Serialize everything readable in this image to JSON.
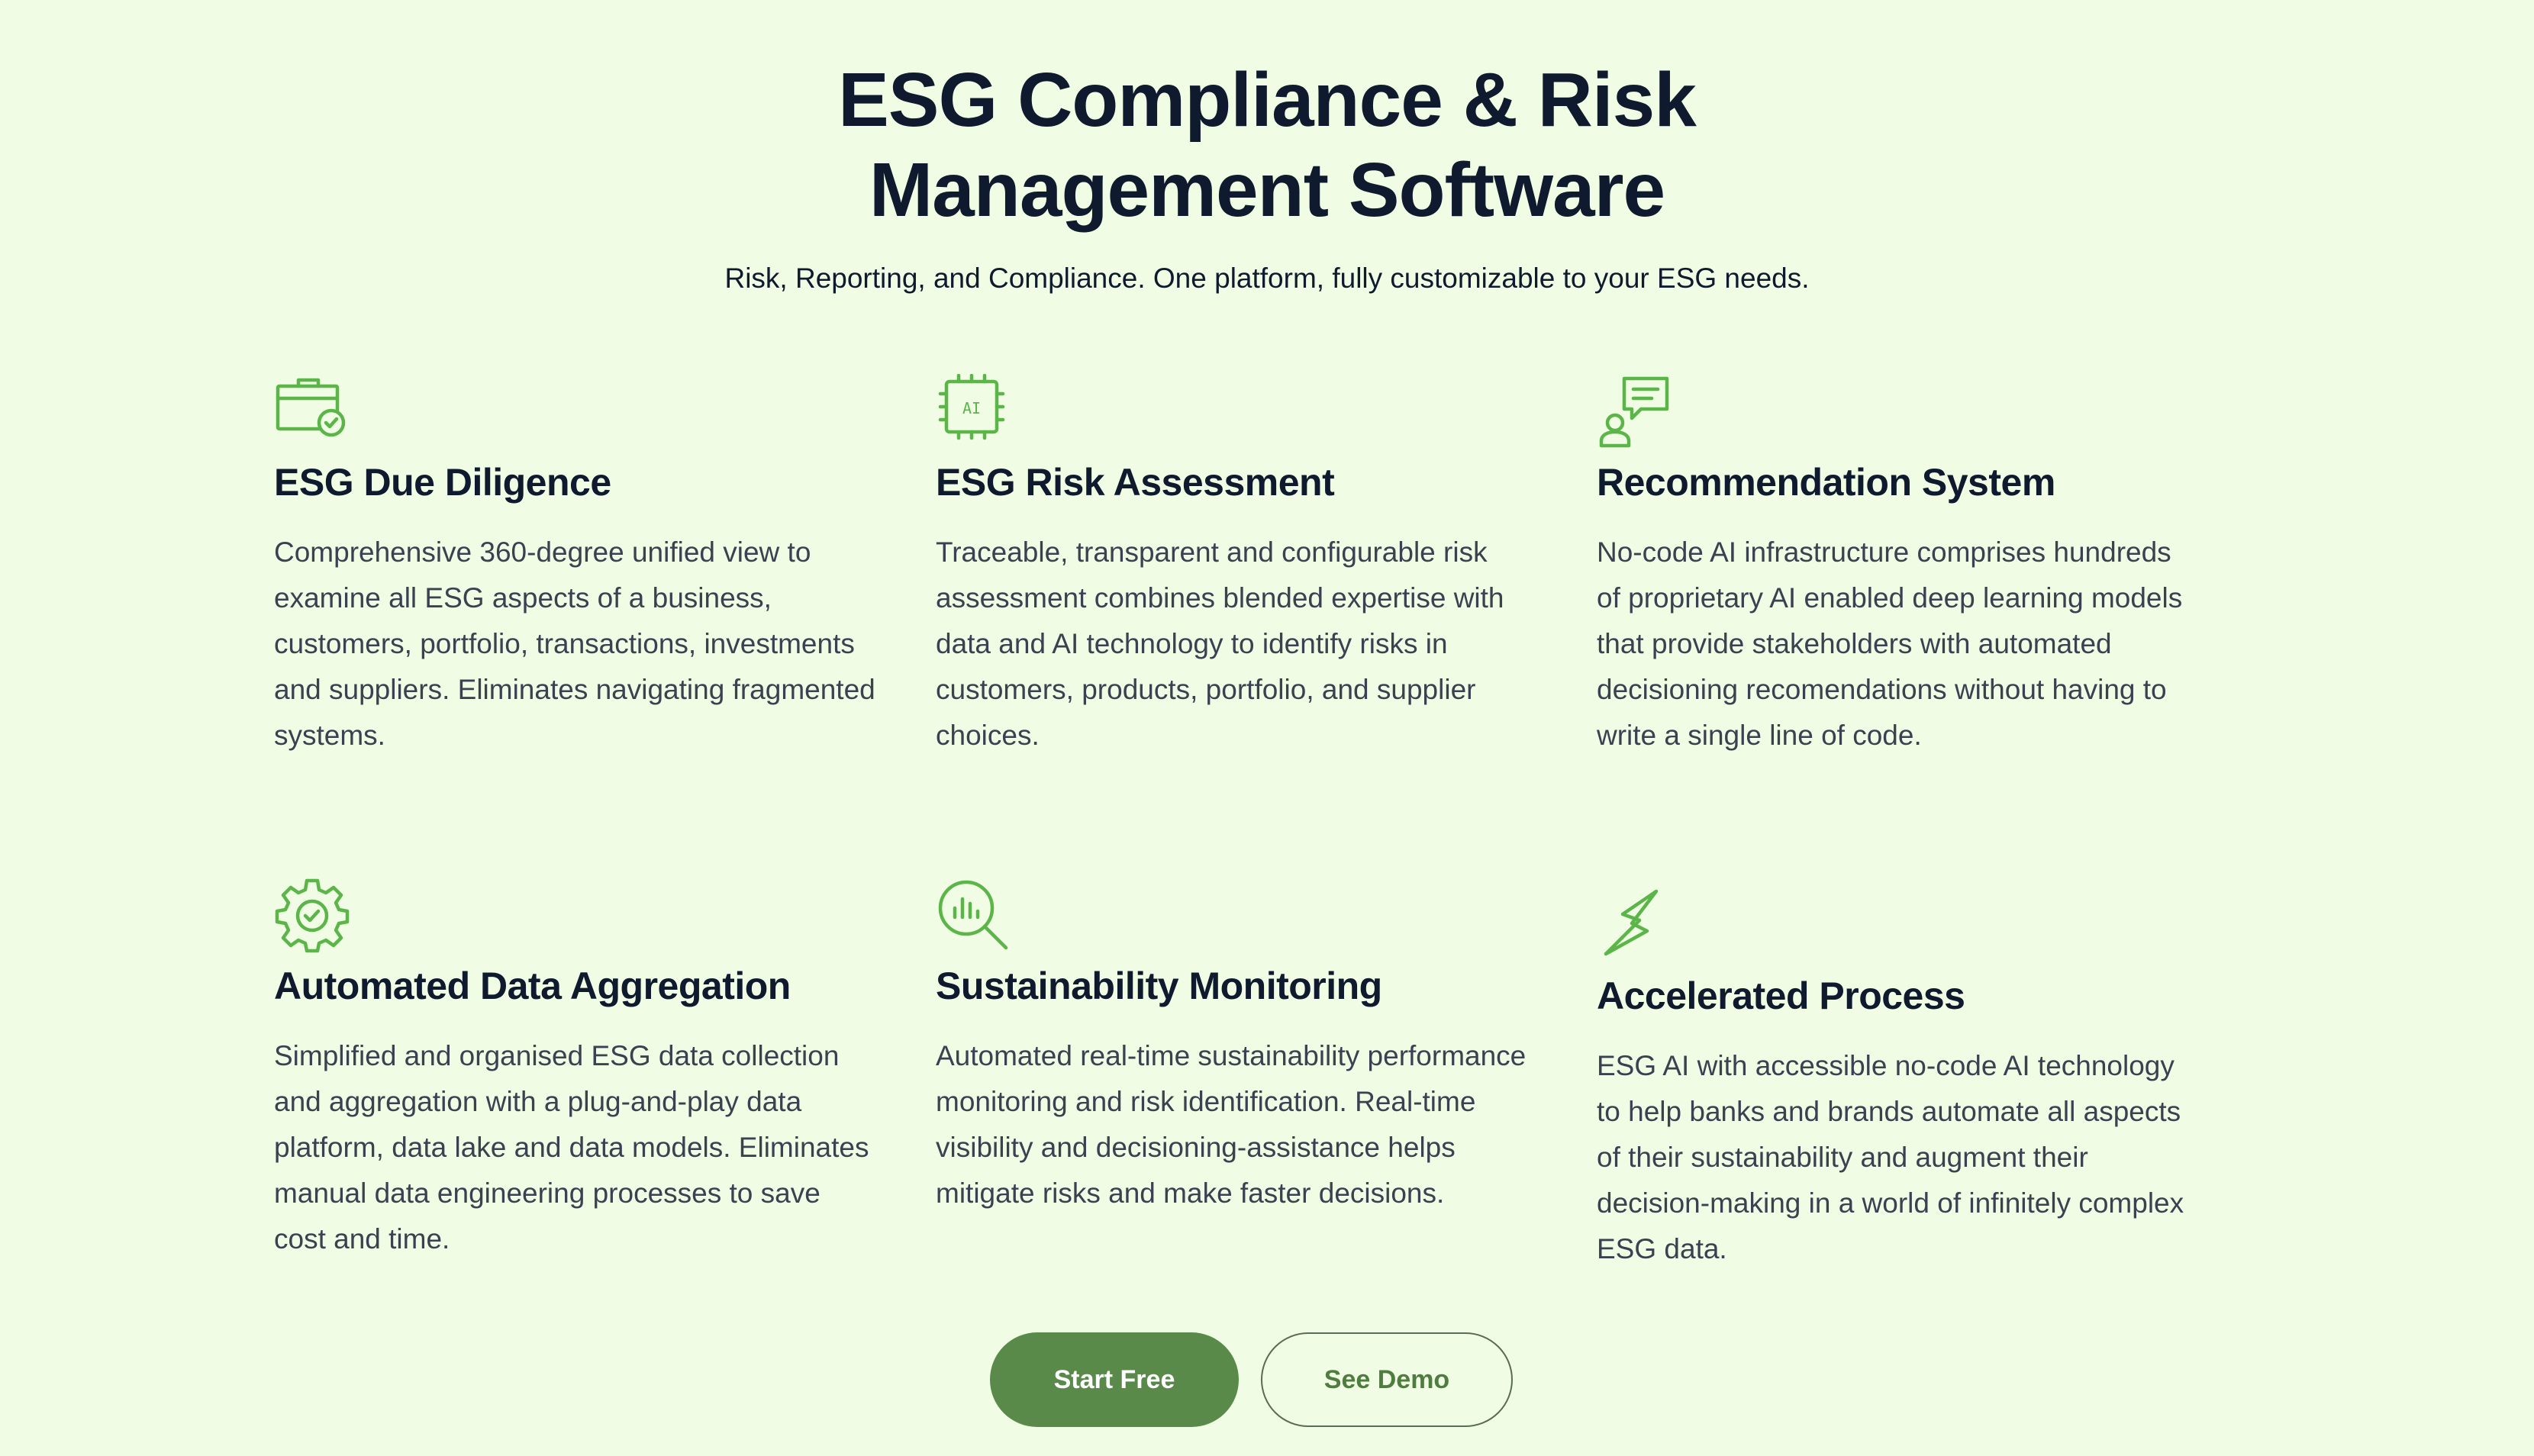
{
  "header": {
    "title_line1": "ESG Compliance & Risk",
    "title_line2": "Management Software",
    "subtitle": "Risk, Reporting, and Compliance. One platform, fully customizable to your ESG needs."
  },
  "colors": {
    "background": "#f0fde4",
    "accent": "#5cb548",
    "primary_button": "#5a8a49",
    "heading": "#0f1a2e",
    "body_text": "#3a4150"
  },
  "features": [
    {
      "icon": "briefcase-check-icon",
      "title": "ESG Due Diligence",
      "description": "Comprehensive 360-degree unified view to examine all ESG aspects of a business, customers, portfolio, transactions, investments and suppliers. Eliminates navigating fragmented systems."
    },
    {
      "icon": "ai-chip-icon",
      "icon_text": "AI",
      "title": "ESG Risk Assessment",
      "description": "Traceable, transparent and configurable risk assessment combines blended expertise with data and AI technology to identify risks in customers, products, portfolio, and supplier choices."
    },
    {
      "icon": "user-chat-icon",
      "title": "Recommendation System",
      "description": "No-code AI infrastructure comprises hundreds of proprietary AI enabled deep learning models that provide stakeholders with automated decisioning recomendations without having to write a single line of code."
    },
    {
      "icon": "gear-check-icon",
      "title": "Automated Data Aggregation",
      "description": "Simplified and organised ESG data collection and aggregation with a plug-and-play data platform, data lake and data models. Eliminates manual data engineering processes to save cost and time."
    },
    {
      "icon": "magnifier-chart-icon",
      "title": "Sustainability Monitoring",
      "description": "Automated real-time sustainability performance monitoring and risk identification. Real-time visibility and decisioning-assistance helps mitigate risks and make faster decisions."
    },
    {
      "icon": "lightning-bolt-icon",
      "title": "Accelerated Process",
      "description": "ESG AI with accessible no-code AI technology to help banks and brands automate all aspects of their sustainability and augment their decision-making in a world of infinitely complex ESG data."
    }
  ],
  "cta": {
    "primary_label": "Start Free",
    "secondary_label": "See Demo"
  }
}
